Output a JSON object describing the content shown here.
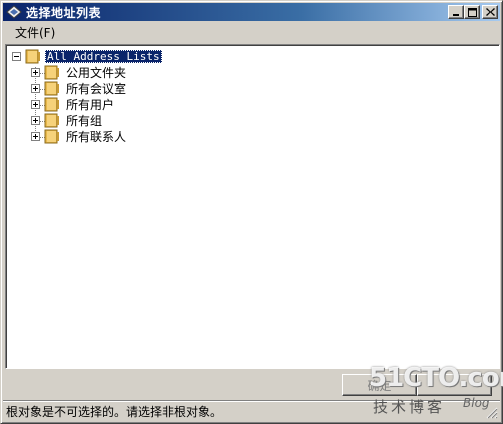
{
  "window": {
    "title": "选择地址列表",
    "buttons": {
      "minimize": "_",
      "maximize": "□",
      "close": "✕"
    }
  },
  "menu": {
    "items": [
      {
        "label": "文件(F)"
      }
    ]
  },
  "tree": {
    "root": {
      "label": "All Address Lists",
      "expanded": true,
      "selected": true
    },
    "children": [
      {
        "label": "公用文件夹"
      },
      {
        "label": "所有会议室"
      },
      {
        "label": "所有用户"
      },
      {
        "label": "所有组"
      },
      {
        "label": "所有联系人"
      }
    ]
  },
  "buttons": {
    "ok": "确定",
    "cancel": ""
  },
  "status": {
    "text": "根对象是不可选择的。请选择非根对象。"
  },
  "watermark": {
    "main": "51CTO.com",
    "sub": "技术博客",
    "blog": "Blog"
  },
  "colors": {
    "titlebar_start": "#0a246a",
    "titlebar_end": "#a6caf0",
    "selection": "#0a246a",
    "chrome": "#d4d0c8",
    "folder": "#e8b84a"
  }
}
